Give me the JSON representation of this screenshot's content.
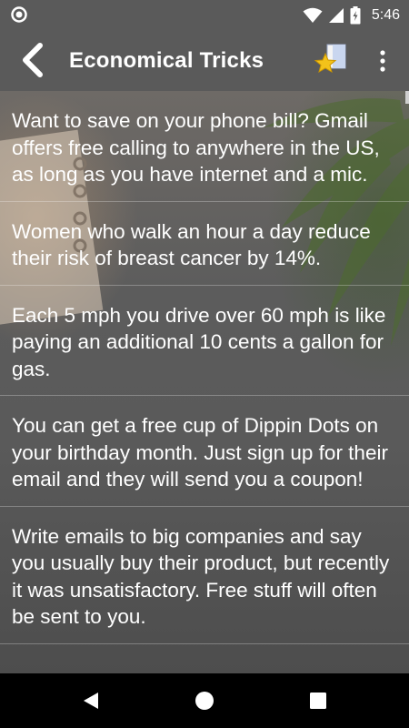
{
  "status_bar": {
    "time": "5:46",
    "icons": [
      "notification-circle-icon",
      "wifi-icon",
      "signal-icon",
      "battery-charging-icon"
    ]
  },
  "app_bar": {
    "title": "Economical Tricks",
    "back_icon": "chevron-left-icon",
    "action_icon": "star-page-icon",
    "overflow_icon": "more-vert-icon"
  },
  "tips": [
    "Want to save on your phone bill? Gmail offers free calling to anywhere in the US, as long as you have internet and a mic.",
    "Women who walk an hour a day reduce their risk of breast cancer by 14%.",
    "Each 5 mph you drive over 60 mph is like paying an additional 10 cents a gallon for gas.",
    "You can get a free cup of Dippin Dots on your birthday month. Just sign up for their email and they will send you a coupon!",
    "Write emails to big companies and say you usually buy their product, but recently it was unsatisfactory. Free stuff will often be sent to you."
  ],
  "nav_bar": {
    "icons": [
      "back-triangle-icon",
      "home-circle-icon",
      "recents-square-icon"
    ]
  },
  "colors": {
    "bar_background": "#5a5a5a",
    "text": "#ffffff",
    "nav_background": "#000000"
  }
}
